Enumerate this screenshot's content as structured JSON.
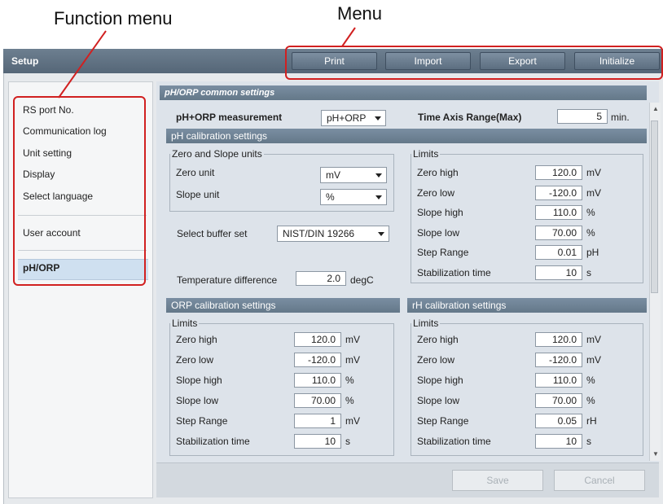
{
  "annotations": {
    "function_menu": "Function menu",
    "menu": "Menu"
  },
  "window": {
    "title": "Setup"
  },
  "menu": {
    "print": "Print",
    "import": "Import",
    "export": "Export",
    "initialize": "Initialize"
  },
  "function_menu": {
    "items": [
      "RS port No.",
      "Communication log",
      "Unit setting",
      "Display",
      "Select language"
    ],
    "user_account": "User account",
    "selected": "pH/ORP"
  },
  "common": {
    "header": "pH/ORP common settings",
    "measurement_label": "pH+ORP measurement",
    "measurement_value": "pH+ORP",
    "time_axis_label": "Time Axis Range(Max)",
    "time_axis_value": "5",
    "time_axis_unit": "min."
  },
  "ph": {
    "header": "pH calibration settings",
    "zero_slope_group": "Zero and Slope units",
    "zero_unit_label": "Zero unit",
    "zero_unit_value": "mV",
    "slope_unit_label": "Slope unit",
    "slope_unit_value": "%",
    "buffer_label": "Select buffer set",
    "buffer_value": "NIST/DIN 19266",
    "temp_label": "Temperature difference",
    "temp_value": "2.0",
    "temp_unit": "degC",
    "limits_title": "Limits",
    "limits": [
      {
        "label": "Zero high",
        "value": "120.0",
        "unit": "mV"
      },
      {
        "label": "Zero low",
        "value": "-120.0",
        "unit": "mV"
      },
      {
        "label": "Slope high",
        "value": "110.0",
        "unit": "%"
      },
      {
        "label": "Slope low",
        "value": "70.00",
        "unit": "%"
      },
      {
        "label": "Step Range",
        "value": "0.01",
        "unit": "pH"
      },
      {
        "label": "Stabilization time",
        "value": "10",
        "unit": "s"
      }
    ]
  },
  "orp": {
    "header": "ORP calibration settings",
    "limits_title": "Limits",
    "limits": [
      {
        "label": "Zero high",
        "value": "120.0",
        "unit": "mV"
      },
      {
        "label": "Zero low",
        "value": "-120.0",
        "unit": "mV"
      },
      {
        "label": "Slope high",
        "value": "110.0",
        "unit": "%"
      },
      {
        "label": "Slope low",
        "value": "70.00",
        "unit": "%"
      },
      {
        "label": "Step Range",
        "value": "1",
        "unit": "mV"
      },
      {
        "label": "Stabilization time",
        "value": "10",
        "unit": "s"
      }
    ]
  },
  "rh": {
    "header": "rH calibration settings",
    "limits_title": "Limits",
    "limits": [
      {
        "label": "Zero high",
        "value": "120.0",
        "unit": "mV"
      },
      {
        "label": "Zero low",
        "value": "-120.0",
        "unit": "mV"
      },
      {
        "label": "Slope high",
        "value": "110.0",
        "unit": "%"
      },
      {
        "label": "Slope low",
        "value": "70.00",
        "unit": "%"
      },
      {
        "label": "Step Range",
        "value": "0.05",
        "unit": "rH"
      },
      {
        "label": "Stabilization time",
        "value": "10",
        "unit": "s"
      }
    ]
  },
  "footer": {
    "save": "Save",
    "cancel": "Cancel"
  },
  "colors": {
    "highlight": "#d12020",
    "header": "#6d7f90"
  }
}
